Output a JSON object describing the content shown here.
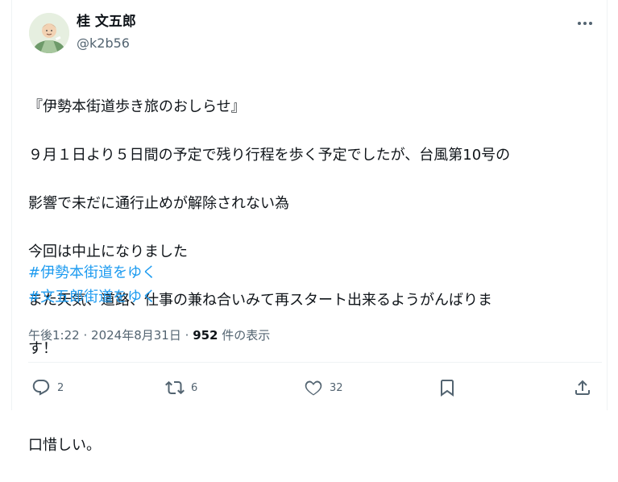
{
  "author": {
    "display_name": "桂 文五郎",
    "handle": "@k2b56"
  },
  "tweet": {
    "lines": [
      "『伊勢本街道歩き旅のおしらせ』",
      "９月１日より５日間の予定で残り行程を歩く予定でしたが、台風第10号の",
      "影響で未だに通行止めが解除されない為",
      "今回は中止になりました",
      "また天気、道路、仕事の兼ね合いみて再スタート出来るようがんばりま",
      "す！",
      "",
      "口惜しい。"
    ],
    "hashtags": [
      "#伊勢本街道をゆく",
      "#文五郎街道をゆく"
    ]
  },
  "meta": {
    "time": "午後1:22",
    "date": "2024年8月31日",
    "views_count": "952",
    "views_label": "件の表示",
    "separator": "·"
  },
  "actions": {
    "reply_count": "2",
    "retweet_count": "6",
    "like_count": "32"
  },
  "icons": {
    "more": "more-icon",
    "reply": "reply-icon",
    "retweet": "retweet-icon",
    "like": "heart-icon",
    "bookmark": "bookmark-icon",
    "share": "share-icon"
  },
  "colors": {
    "text": "#0f1419",
    "secondary": "#536471",
    "link": "#1d9bf0"
  }
}
